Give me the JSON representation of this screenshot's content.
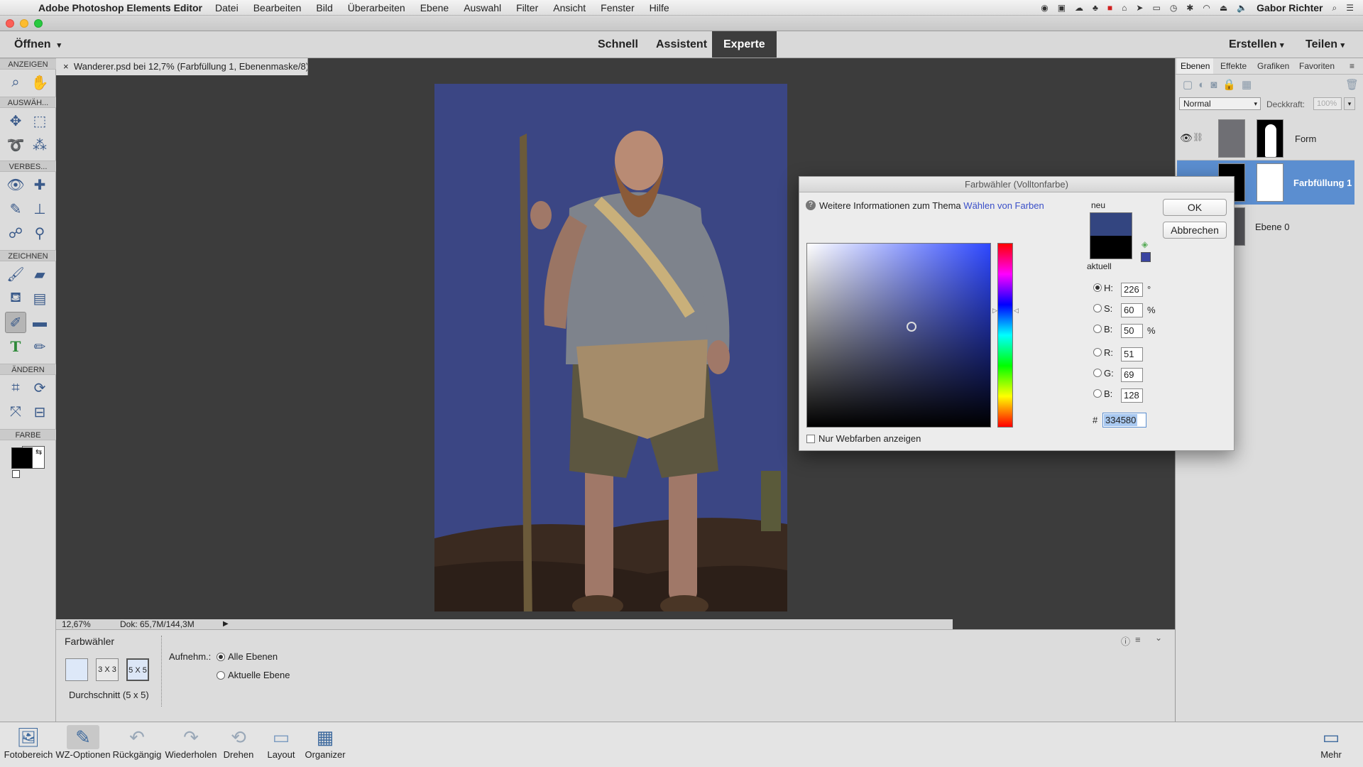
{
  "menubar": {
    "app_name": "Adobe Photoshop Elements Editor",
    "items": [
      "Datei",
      "Bearbeiten",
      "Bild",
      "Überarbeiten",
      "Ebene",
      "Auswahl",
      "Filter",
      "Ansicht",
      "Fenster",
      "Hilfe"
    ],
    "user": "Gabor Richter"
  },
  "modebar": {
    "open_label": "Öffnen",
    "modes": [
      "Schnell",
      "Assistent",
      "Experte"
    ],
    "active_mode": "Experte",
    "create_label": "Erstellen",
    "share_label": "Teilen"
  },
  "toolbox": {
    "sections": [
      "ANZEIGEN",
      "AUSWÄH...",
      "VERBES...",
      "ZEICHNEN",
      "ÄNDERN",
      "FARBE"
    ],
    "foreground_color": "#000000",
    "background_color": "#ffffff"
  },
  "document": {
    "tab_title": "Wanderer.psd bei 12,7% (Farbfüllung 1, Ebenenmaske/8) *",
    "background_color": "#3b4684",
    "zoom": "12,67%",
    "doc_info": "Dok: 65,7M/144,3M"
  },
  "panel": {
    "tabs": [
      "Ebenen",
      "Effekte",
      "Grafiken",
      "Favoriten"
    ],
    "blend_mode": "Normal",
    "opacity_label": "Deckkraft:",
    "opacity_value": "100%",
    "layers": [
      {
        "name": "Form"
      },
      {
        "name": "Farbfüllung 1"
      },
      {
        "name": "Ebene 0"
      }
    ]
  },
  "dialog": {
    "title": "Farbwähler (Volltonfarbe)",
    "info_text": "Weitere Informationen zum Thema",
    "info_link": "Wählen von Farben",
    "new_label": "neu",
    "current_label": "aktuell",
    "ok_label": "OK",
    "cancel_label": "Abbrechen",
    "new_color": "#334580",
    "current_color": "#000000",
    "fields": [
      {
        "label": "H:",
        "value": "226",
        "unit": "°"
      },
      {
        "label": "S:",
        "value": "60",
        "unit": "%"
      },
      {
        "label": "B:",
        "value": "50",
        "unit": "%"
      },
      {
        "label": "R:",
        "value": "51",
        "unit": ""
      },
      {
        "label": "G:",
        "value": "69",
        "unit": ""
      },
      {
        "label": "B:",
        "value": "128",
        "unit": ""
      }
    ],
    "hex_label": "#",
    "hex_value": "334580",
    "web_colors_label": "Nur Webfarben anzeigen"
  },
  "options": {
    "tool_name": "Farbwähler",
    "sample_sizes": [
      "",
      "3 X 3",
      "5 X 5"
    ],
    "sample_label": "Durchschnitt (5 x 5)",
    "sample_from_label": "Aufnehm.:",
    "radio_all": "Alle Ebenen",
    "radio_current": "Aktuelle Ebene"
  },
  "bottombar": {
    "items": [
      "Fotobereich",
      "WZ-Optionen",
      "Rückgängig",
      "Wiederholen",
      "Drehen",
      "Layout",
      "Organizer"
    ],
    "more_label": "Mehr"
  }
}
